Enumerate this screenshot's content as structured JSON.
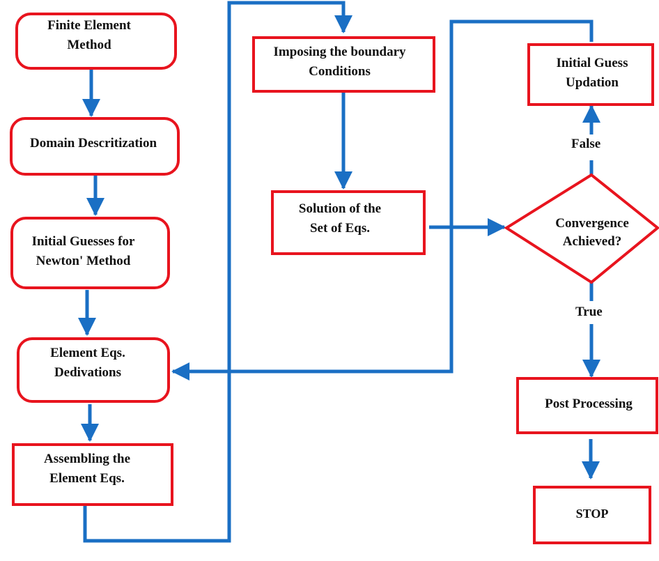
{
  "colors": {
    "box_border": "#e8141e",
    "arrow": "#1a6fc4",
    "text": "#111111",
    "background": "#ffffff"
  },
  "nodes": {
    "fem": {
      "label": "Finite Element\nMethod",
      "shape": "rounded-rect"
    },
    "domain": {
      "label": "Domain Descritization",
      "shape": "rounded-rect"
    },
    "guesses": {
      "label": "Initial Guesses for\nNewton' Method",
      "shape": "rounded-rect"
    },
    "element_eqs": {
      "label": "Element Eqs.\nDedivations",
      "shape": "rounded-rect"
    },
    "assembling": {
      "label": "Assembling the\nElement Eqs.",
      "shape": "rect"
    },
    "boundary": {
      "label": "Imposing the boundary\nConditions",
      "shape": "rect"
    },
    "solution": {
      "label": "Solution of the\nSet of Eqs.",
      "shape": "rect"
    },
    "update": {
      "label": "Initial Guess\nUpdation",
      "shape": "rect"
    },
    "convergence": {
      "label": "Convergence\nAchieved?",
      "shape": "diamond"
    },
    "post": {
      "label": "Post Processing",
      "shape": "rect"
    },
    "stop": {
      "label": "STOP",
      "shape": "rect"
    }
  },
  "edges": [
    {
      "from": "fem",
      "to": "domain"
    },
    {
      "from": "domain",
      "to": "guesses"
    },
    {
      "from": "guesses",
      "to": "element_eqs"
    },
    {
      "from": "element_eqs",
      "to": "assembling"
    },
    {
      "from": "assembling",
      "to": "boundary"
    },
    {
      "from": "boundary",
      "to": "solution"
    },
    {
      "from": "solution",
      "to": "convergence"
    },
    {
      "from": "convergence",
      "to": "update",
      "label": "False"
    },
    {
      "from": "update",
      "to": "element_eqs"
    },
    {
      "from": "convergence",
      "to": "post",
      "label": "True"
    },
    {
      "from": "post",
      "to": "stop"
    }
  ],
  "edge_labels": {
    "false": "False",
    "true": "True"
  }
}
